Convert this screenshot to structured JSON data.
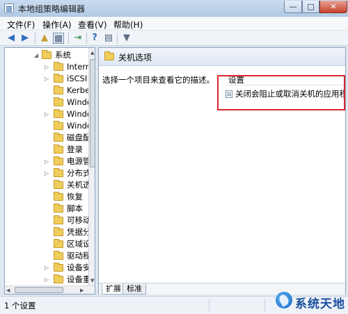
{
  "window": {
    "title": "本地组策略编辑器",
    "min_symbol": "—",
    "max_symbol": "□",
    "close_symbol": "✕"
  },
  "menu": [
    {
      "label": "文件(F)"
    },
    {
      "label": "操作(A)"
    },
    {
      "label": "查看(V)"
    },
    {
      "label": "帮助(H)"
    }
  ],
  "toolbar": {
    "back_icon": "◀",
    "forward_icon": "▶",
    "up_icon": "▲",
    "show_hide_icon": "▦",
    "export_icon": "⇥",
    "help_icon": "?",
    "properties_icon": "▤",
    "filter_icon": "▼"
  },
  "tree": {
    "items": [
      {
        "label": "系统",
        "expander": "◢"
      },
      {
        "label": "Internet",
        "expander": "▷"
      },
      {
        "label": "iSCSI",
        "expander": "▷"
      },
      {
        "label": "Kerberos",
        "expander": ""
      },
      {
        "label": "Windows",
        "expander": ""
      },
      {
        "label": "Windows",
        "expander": "▷"
      },
      {
        "label": "Windows",
        "expander": ""
      },
      {
        "label": "磁盘配额",
        "expander": ""
      },
      {
        "label": "登录",
        "expander": ""
      },
      {
        "label": "电源管理",
        "expander": "▷"
      },
      {
        "label": "分布式",
        "expander": "▷"
      },
      {
        "label": "关机选项",
        "expander": ""
      },
      {
        "label": "恢复",
        "expander": ""
      },
      {
        "label": "脚本",
        "expander": ""
      },
      {
        "label": "可移动",
        "expander": ""
      },
      {
        "label": "凭据分",
        "expander": ""
      },
      {
        "label": "区域设",
        "expander": ""
      },
      {
        "label": "驱动程",
        "expander": ""
      },
      {
        "label": "设备安",
        "expander": "▷"
      },
      {
        "label": "设备重",
        "expander": "▷"
      }
    ]
  },
  "right_pane": {
    "header_title": "关机选项",
    "description": "选择一个项目来查看它的描述。",
    "settings_header": "设置",
    "settings": [
      {
        "label": "关闭会阻止或取消关机的应用程序的自动终止功能"
      }
    ],
    "tabs": [
      {
        "label": "扩展"
      },
      {
        "label": "标准"
      }
    ]
  },
  "statusbar": {
    "text": "1 个设置"
  },
  "watermark": {
    "text": "系统天地"
  }
}
